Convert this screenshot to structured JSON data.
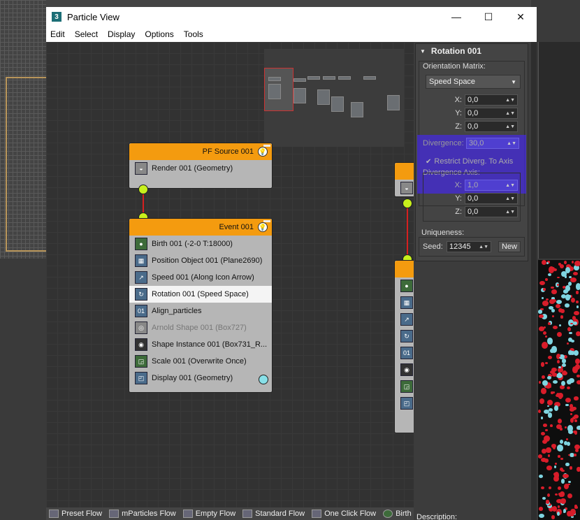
{
  "window": {
    "app_icon": "3",
    "title": "Particle View",
    "controls": {
      "minimize": "—",
      "maximize": "☐",
      "close": "✕"
    }
  },
  "menu": [
    "Edit",
    "Select",
    "Display",
    "Options",
    "Tools"
  ],
  "nodes": {
    "source": {
      "title": "PF Source 001",
      "operators": [
        {
          "label": "Render 001 (Geometry)",
          "icon": "teapot-icon"
        }
      ]
    },
    "event": {
      "title": "Event 001",
      "operators": [
        {
          "label": "Birth 001 (-2-0 T:18000)",
          "icon": "birth-icon"
        },
        {
          "label": "Position Object 001 (Plane2690)",
          "icon": "position-object-icon"
        },
        {
          "label": "Speed 001 (Along Icon Arrow)",
          "icon": "speed-icon"
        },
        {
          "label": "Rotation 001 (Speed Space)",
          "icon": "rotation-icon"
        },
        {
          "label": "Align_particles",
          "icon": "script-icon"
        },
        {
          "label": "Arnold Shape 001 (Box727)",
          "icon": "arnold-shape-icon"
        },
        {
          "label": "Shape Instance 001 (Box731_R...",
          "icon": "shape-instance-icon"
        },
        {
          "label": "Scale 001 (Overwrite Once)",
          "icon": "scale-icon"
        },
        {
          "label": "Display 001 (Geometry)",
          "icon": "display-icon"
        }
      ]
    }
  },
  "depot": [
    {
      "label": "Preset Flow",
      "icon": "flow-icon"
    },
    {
      "label": "mParticles Flow",
      "icon": "flow-icon"
    },
    {
      "label": "Empty Flow",
      "icon": "flow-icon"
    },
    {
      "label": "Standard Flow",
      "icon": "flow-icon"
    },
    {
      "label": "One Click Flow",
      "icon": "flow-icon"
    },
    {
      "label": "Birth",
      "icon": "birth-icon"
    }
  ],
  "panel": {
    "rollout_title": "Rotation 001",
    "orientation_label": "Orientation Matrix:",
    "orientation_value": "Speed Space",
    "x_label": "X:",
    "x_value": "0,0",
    "y_label": "Y:",
    "y_value": "0,0",
    "z_label": "Z:",
    "z_value": "0,0",
    "divergence_label": "Divergence:",
    "divergence_value": "30,0",
    "restrict_label": "Restrict Diverg. To Axis",
    "axis_label": "Divergence Axis:",
    "axis_x_label": "X:",
    "axis_x_value": "1,0",
    "axis_y_label": "Y:",
    "axis_y_value": "0,0",
    "axis_z_label": "Z:",
    "axis_z_value": "0,0",
    "uniqueness_label": "Uniqueness:",
    "seed_label": "Seed:",
    "seed_value": "12345",
    "new_button": "New",
    "description_label": "Description:"
  },
  "colors": {
    "node_header": "#f49b0f",
    "port": "#c8f01c",
    "wire": "#d62020",
    "highlight": "#4428e6"
  }
}
